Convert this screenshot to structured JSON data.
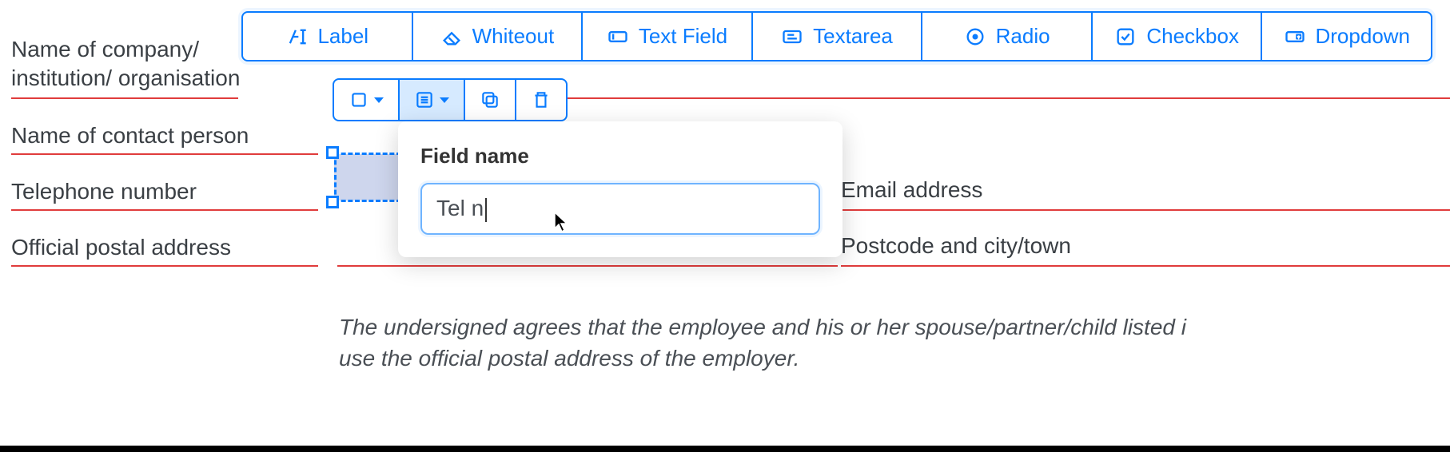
{
  "toolbar": [
    {
      "id": "label",
      "label": "Label"
    },
    {
      "id": "whiteout",
      "label": "Whiteout"
    },
    {
      "id": "textfield",
      "label": "Text Field"
    },
    {
      "id": "textarea",
      "label": "Textarea"
    },
    {
      "id": "radio",
      "label": "Radio"
    },
    {
      "id": "checkbox",
      "label": "Checkbox"
    },
    {
      "id": "dropdown",
      "label": "Dropdown"
    }
  ],
  "form": {
    "company_label": "Name of company/\ninstitution/ organisation",
    "contact_label": "Name of contact person",
    "telephone_label": "Telephone number",
    "email_label": "Email address",
    "postal_label": "Official postal address",
    "postcode_label": "Postcode and city/town"
  },
  "popover": {
    "title": "Field name",
    "input_value": "Tel n"
  },
  "disclaimer_line1": "The undersigned agrees that the employee and his or her spouse/partner/child listed i",
  "disclaimer_line2": "use the official postal address of the employer.",
  "colors": {
    "primary": "#0a7cff",
    "redline": "#e03c3c"
  }
}
